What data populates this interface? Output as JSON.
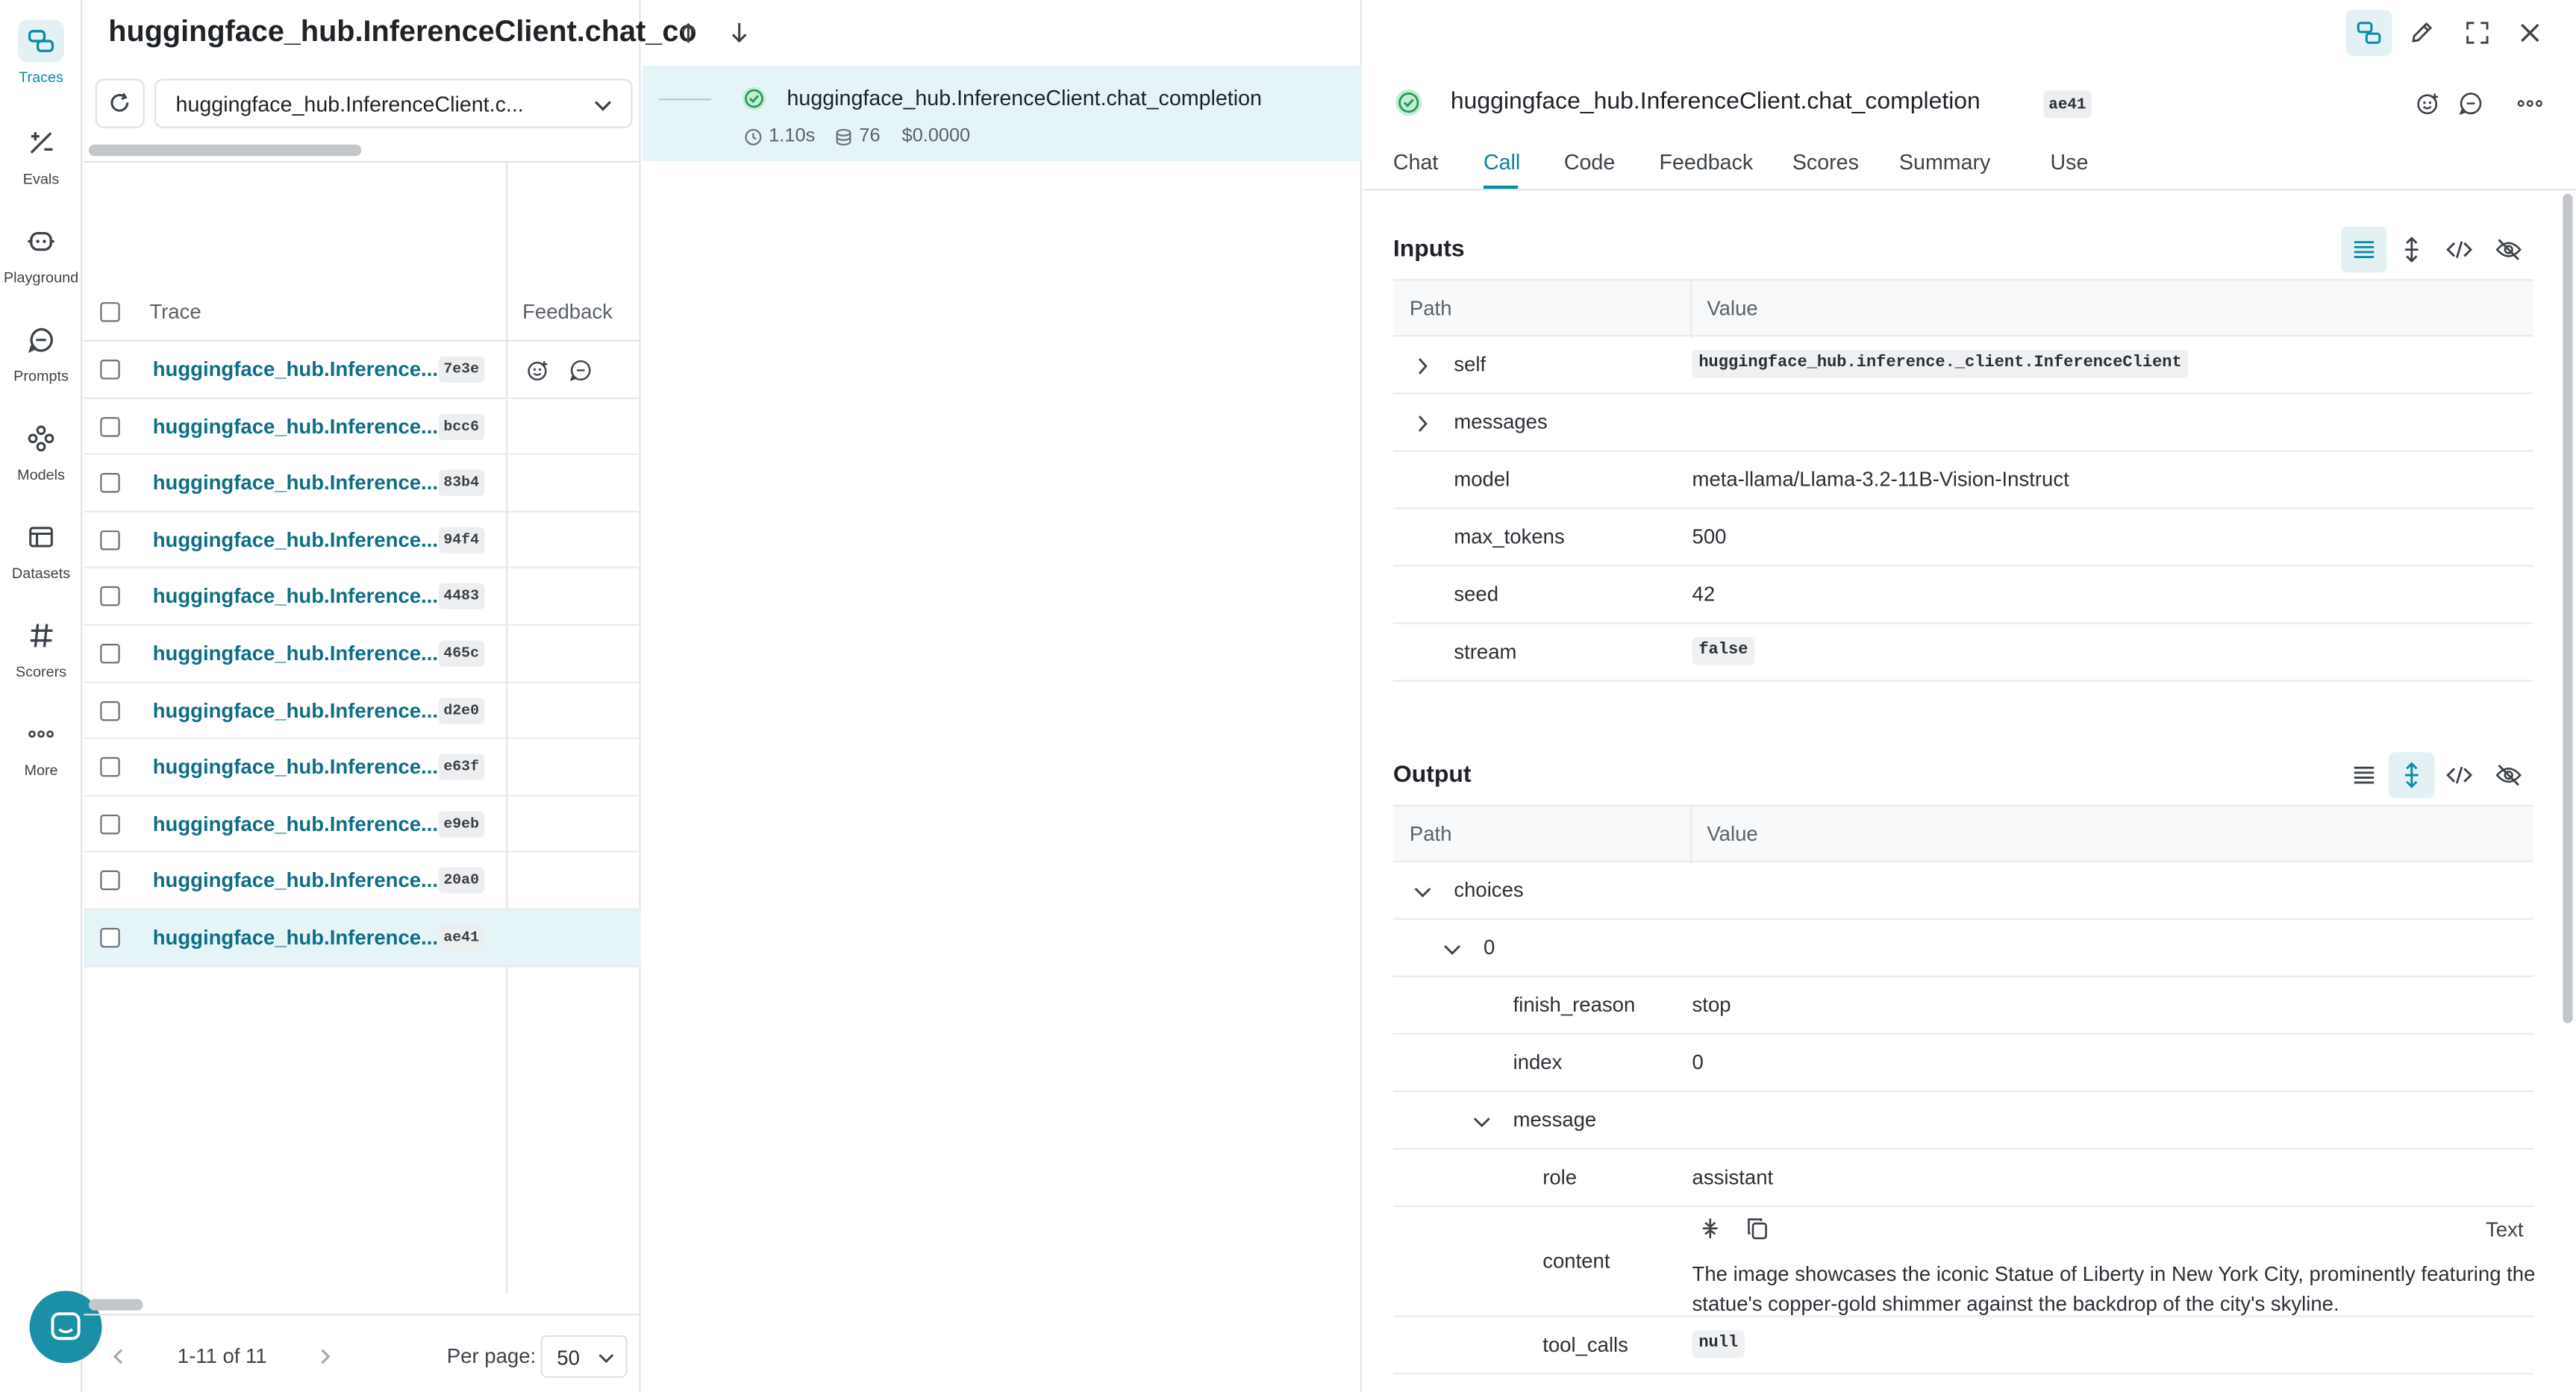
{
  "nav": {
    "items": [
      {
        "label": "Traces",
        "icon": "traces-icon",
        "active": true
      },
      {
        "label": "Evals",
        "icon": "evals-icon"
      },
      {
        "label": "Playground",
        "icon": "playground-icon"
      },
      {
        "label": "Prompts",
        "icon": "prompts-icon"
      },
      {
        "label": "Models",
        "icon": "models-icon"
      },
      {
        "label": "Datasets",
        "icon": "datasets-icon"
      },
      {
        "label": "Scorers",
        "icon": "scorers-icon"
      },
      {
        "label": "More",
        "icon": "more-icon"
      }
    ]
  },
  "list": {
    "title": "huggingface_hub.InferenceClient.chat_co",
    "filter_value": "huggingface_hub.InferenceClient.c...",
    "columns": {
      "trace": "Trace",
      "feedback": "Feedback"
    },
    "rows": [
      {
        "name": "huggingface_hub.Inference...",
        "hash": "7e3e"
      },
      {
        "name": "huggingface_hub.Inference...",
        "hash": "bcc6"
      },
      {
        "name": "huggingface_hub.Inference...",
        "hash": "83b4"
      },
      {
        "name": "huggingface_hub.Inference...",
        "hash": "94f4"
      },
      {
        "name": "huggingface_hub.Inference...",
        "hash": "4483"
      },
      {
        "name": "huggingface_hub.Inference...",
        "hash": "465c"
      },
      {
        "name": "huggingface_hub.Inference...",
        "hash": "d2e0"
      },
      {
        "name": "huggingface_hub.Inference...",
        "hash": "e63f"
      },
      {
        "name": "huggingface_hub.Inference...",
        "hash": "e9eb"
      },
      {
        "name": "huggingface_hub.Inference...",
        "hash": "20a0"
      },
      {
        "name": "huggingface_hub.Inference...",
        "hash": "ae41",
        "selected": true
      }
    ],
    "pager": {
      "range": "1-11 of 11",
      "per_page_label": "Per page:",
      "per_page_value": "50"
    }
  },
  "tree": {
    "call_name": "huggingface_hub.InferenceClient.chat_completion",
    "duration": "1.10s",
    "tokens": "76",
    "cost": "$0.0000"
  },
  "detail": {
    "title": "huggingface_hub.InferenceClient.chat_completion",
    "hash": "ae41",
    "tabs": [
      "Chat",
      "Call",
      "Code",
      "Feedback",
      "Scores",
      "Summary",
      "Use"
    ],
    "active_tab": "Call",
    "inputs": {
      "title": "Inputs",
      "path_header": "Path",
      "value_header": "Value",
      "rows": [
        {
          "key": "self",
          "value": "huggingface_hub.inference._client.InferenceClient",
          "code": true,
          "expandable": true
        },
        {
          "key": "messages",
          "value": "",
          "expandable": true
        },
        {
          "key": "model",
          "value": "meta-llama/Llama-3.2-11B-Vision-Instruct"
        },
        {
          "key": "max_tokens",
          "value": "500"
        },
        {
          "key": "seed",
          "value": "42"
        },
        {
          "key": "stream",
          "value": "false",
          "code": true
        }
      ]
    },
    "output": {
      "title": "Output",
      "path_header": "Path",
      "value_header": "Value",
      "rows": [
        {
          "key": "choices",
          "value": ""
        },
        {
          "key": "0",
          "value": ""
        },
        {
          "key": "finish_reason",
          "value": "stop"
        },
        {
          "key": "index",
          "value": "0"
        },
        {
          "key": "message",
          "value": ""
        },
        {
          "key": "role",
          "value": "assistant"
        },
        {
          "key": "content",
          "format": "Text",
          "value_line1": "The image showcases the iconic Statue of Liberty in New York City, prominently featuring the",
          "value_line2": "statue's copper-gold shimmer against the backdrop of the city's skyline."
        },
        {
          "key": "tool_calls",
          "value": "null",
          "code": true
        }
      ]
    }
  }
}
